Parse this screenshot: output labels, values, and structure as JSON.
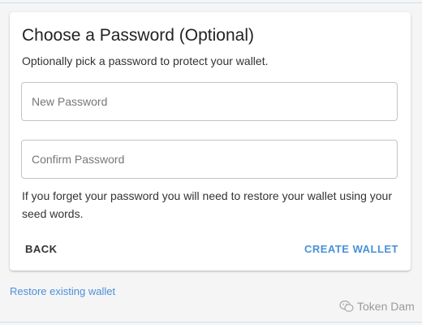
{
  "card": {
    "title": "Choose a Password (Optional)",
    "subtitle": "Optionally pick a password to protect your wallet.",
    "new_password_placeholder": "New Password",
    "confirm_password_placeholder": "Confirm Password",
    "warning": "If you forget your password you will need to restore your wallet using your seed words.",
    "back_label": "BACK",
    "create_label": "CREATE WALLET"
  },
  "restore_link": "Restore existing wallet",
  "watermark": {
    "text": "Token Dam",
    "icon": "wechat-icon"
  },
  "colors": {
    "accent": "#4a90d9",
    "background": "#f5f5f5",
    "card": "#ffffff"
  }
}
